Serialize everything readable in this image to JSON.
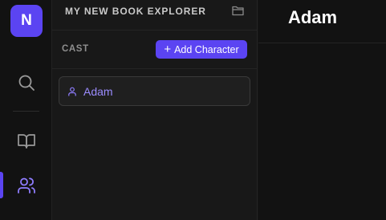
{
  "app": {
    "logo_letter": "N",
    "accent": "#5b44f2"
  },
  "rail": {
    "items": [
      {
        "name": "search",
        "icon": "search-icon",
        "active": false
      },
      {
        "name": "book",
        "icon": "book-icon",
        "active": false
      },
      {
        "name": "cast",
        "icon": "users-icon",
        "active": true
      }
    ]
  },
  "explorer": {
    "title": "MY NEW BOOK EXPLORER",
    "folder_icon": "folder-icon",
    "section_title": "CAST",
    "add_button_label": "Add Character",
    "characters": [
      {
        "name": "Adam",
        "icon": "person-icon"
      }
    ]
  },
  "main": {
    "title": "Adam"
  }
}
